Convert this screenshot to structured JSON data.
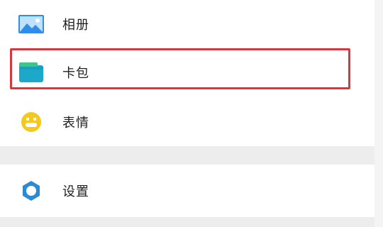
{
  "menu": {
    "items": [
      {
        "label": "相册",
        "icon": "photo-album-icon",
        "color": "#2f8ee8"
      },
      {
        "label": "卡包",
        "icon": "card-wallet-icon",
        "color": "#1ca9c9"
      },
      {
        "label": "表情",
        "icon": "smiley-face-icon",
        "color": "#f4c81d"
      }
    ],
    "settings": {
      "label": "设置",
      "icon": "settings-gear-icon",
      "color": "#2a8ad6"
    }
  },
  "highlight": {
    "target": "卡包",
    "color": "#d9363e"
  }
}
